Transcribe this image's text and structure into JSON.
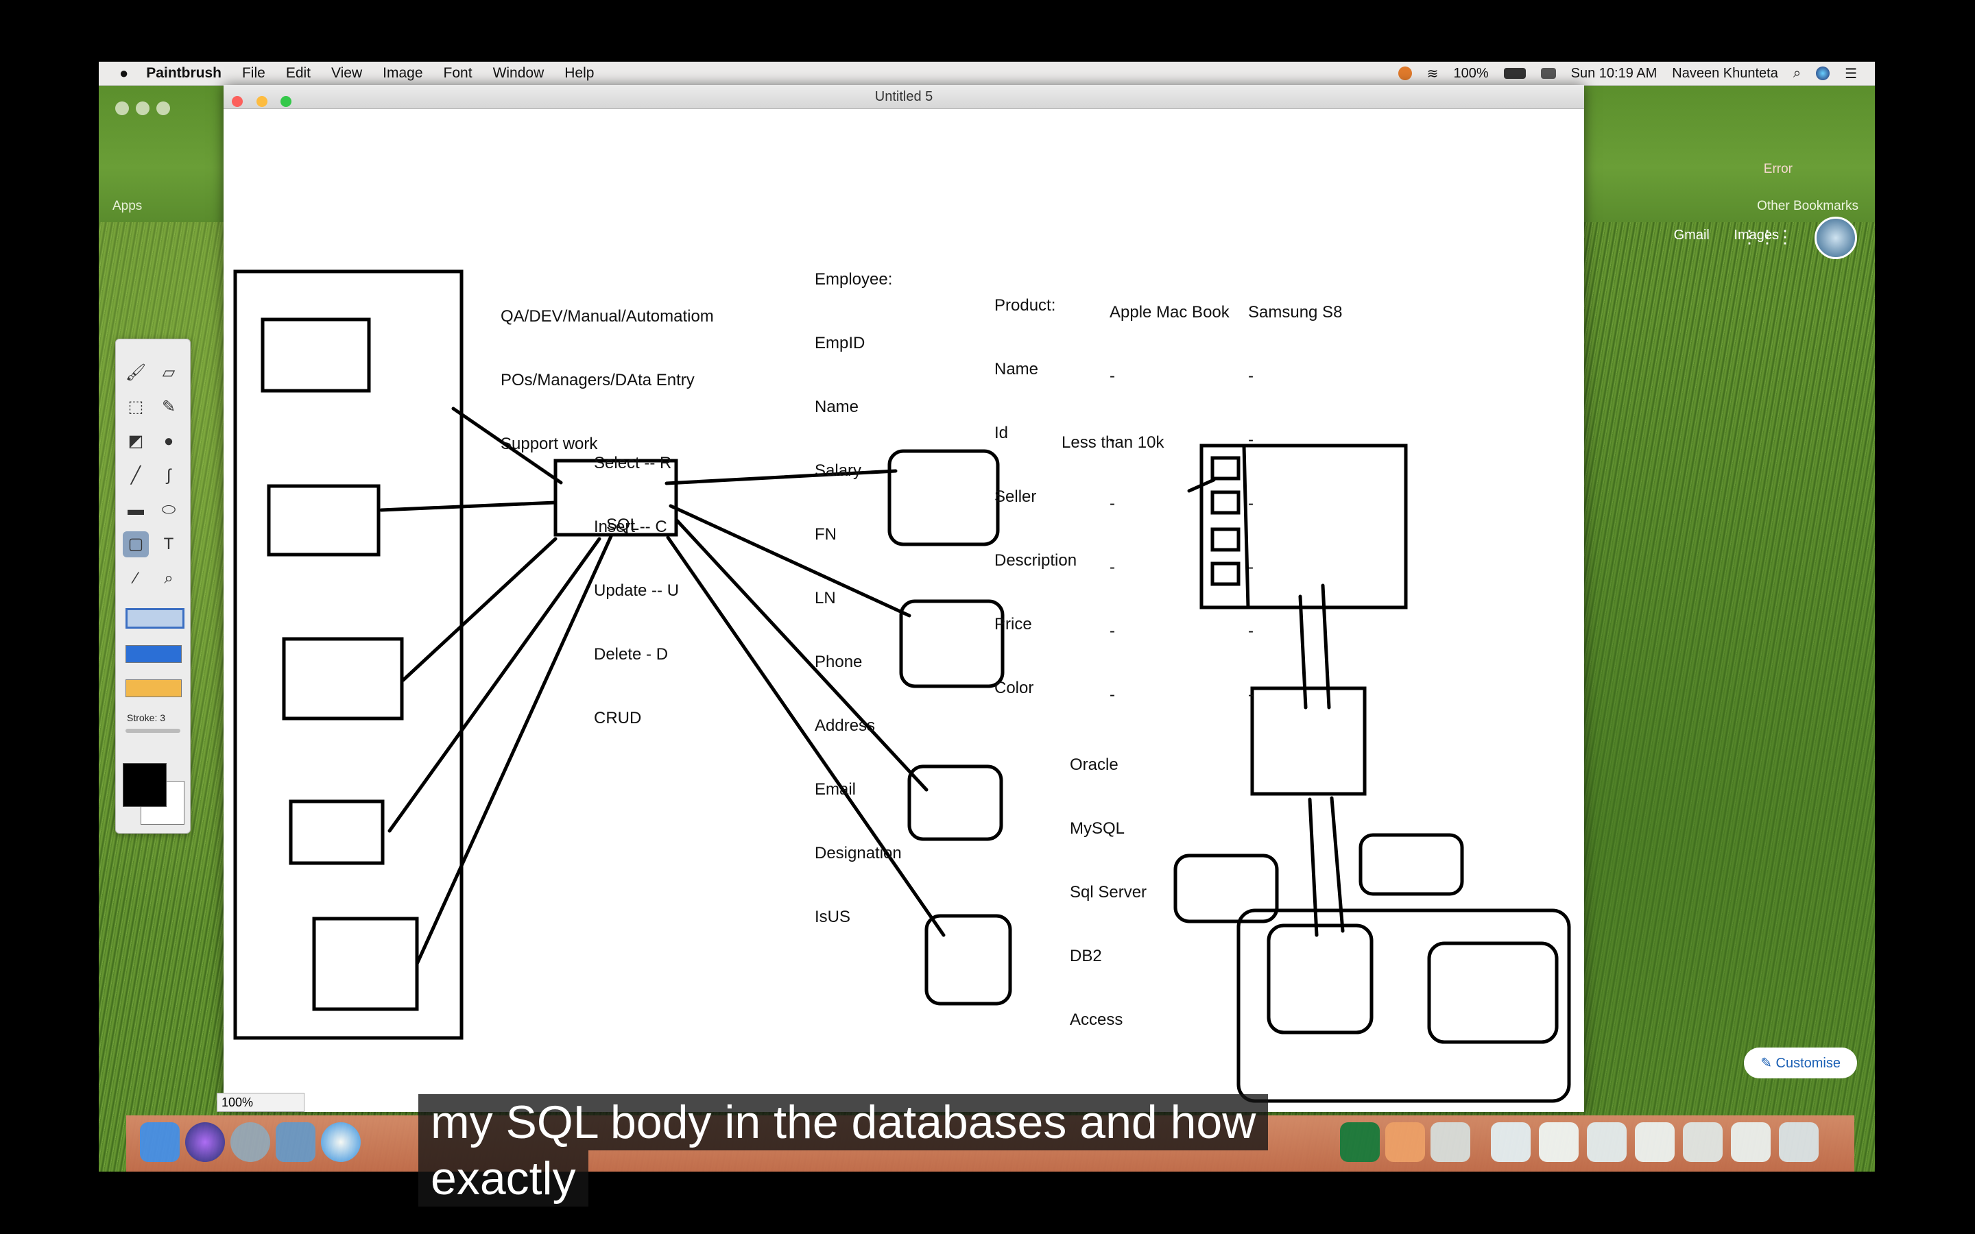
{
  "menubar": {
    "apple": "",
    "app_name": "Paintbrush",
    "items": [
      "File",
      "Edit",
      "View",
      "Image",
      "Font",
      "Window",
      "Help"
    ],
    "battery": "100%",
    "clock": "Sun 10:19 AM",
    "user": "Naveen Khunteta"
  },
  "browser": {
    "bookmarks_left": "Apps",
    "bookmarks_right": "Other Bookmarks",
    "error_label": "Error",
    "google_links": [
      "Gmail",
      "Images"
    ],
    "customise_label": "Customise"
  },
  "paintbrush": {
    "window_title": "Untitled 5",
    "zoom": "100%",
    "stroke_label": "Stroke: 3",
    "tools": [
      "paintbrush-icon",
      "eraser-icon",
      "selection-icon",
      "pencil-icon",
      "fill-icon",
      "bomb-icon",
      "line-icon",
      "curve-icon",
      "rectangle-icon",
      "ellipse-icon",
      "rounded-rect-icon",
      "text-icon",
      "eyedropper-icon",
      "zoom-icon"
    ]
  },
  "canvas": {
    "roles": [
      "QA/DEV/Manual/Automatiom",
      "POs/Managers/DAta Entry",
      "Support work"
    ],
    "crud": [
      "Select -- R",
      "Insert -- C",
      "Update -- U",
      "Delete - D",
      "CRUD"
    ],
    "employee": [
      "Employee:",
      "EmpID",
      "Name",
      "Salary",
      "FN",
      "LN",
      "Phone",
      "Address",
      "Email",
      "Designation",
      "IsUS"
    ],
    "product": [
      "Product:",
      "Name",
      "Id",
      "Seller",
      "Description",
      "Price",
      "Color"
    ],
    "product_cols": [
      "Apple Mac Book",
      "Samsung S8"
    ],
    "dash": "-",
    "less_than": "Less than 10k",
    "databases": [
      "Oracle",
      "MySQL",
      "Sql Server",
      "DB2",
      "Access"
    ],
    "sql_label": "SQL"
  },
  "subtitle": {
    "line1": "my SQL body in the databases and how",
    "line2": "exactly"
  },
  "colors": {
    "foreground": "#000000",
    "background": "#ffffff",
    "swatch_blue": "#2b6fd6",
    "swatch_yellow": "#f2b84b"
  }
}
